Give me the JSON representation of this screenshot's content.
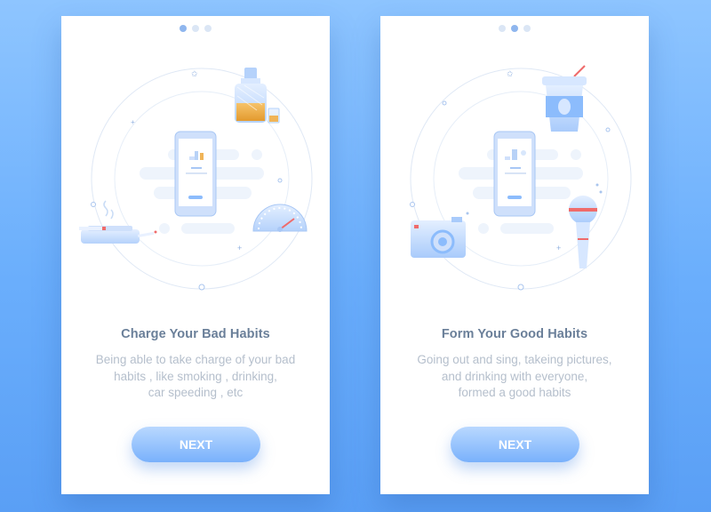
{
  "cards": [
    {
      "step_dots": [
        true,
        false,
        false
      ],
      "title": "Charge Your Bad Habits",
      "description": [
        "Being able to take charge of your bad",
        "habits , like smoking , drinking,",
        "car speeding , etc"
      ],
      "button_label": "NEXT",
      "illustration_icons": [
        "phone-icon",
        "whiskey-bottle-icon",
        "glass-icon",
        "ashtray-cigarette-icon",
        "speedometer-icon"
      ]
    },
    {
      "step_dots": [
        false,
        true,
        false
      ],
      "title": "Form Your Good Habits",
      "description": [
        "Going out and sing, takeing pictures,",
        "and drinking with everyone,",
        "formed a good habits"
      ],
      "button_label": "NEXT",
      "illustration_icons": [
        "phone-icon",
        "coffee-cup-icon",
        "camera-icon",
        "microphone-icon"
      ]
    }
  ],
  "colors": {
    "background": "#7ab8fd",
    "title": "#6a7f99",
    "description": "#b5bfcc",
    "button": "#8cbcfc",
    "accent_red": "#ef6b6b"
  }
}
